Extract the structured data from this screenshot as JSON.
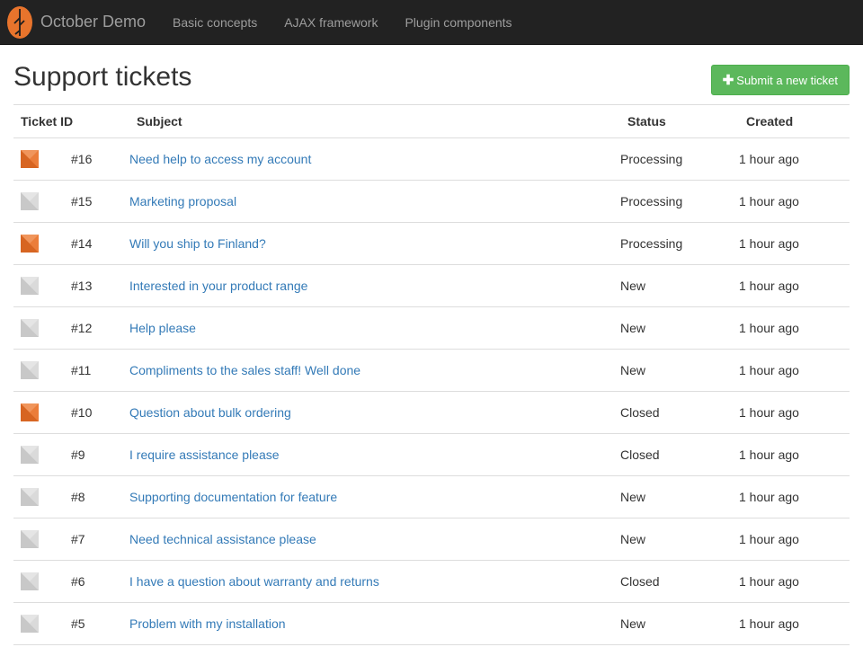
{
  "navbar": {
    "brand": "October Demo",
    "links": [
      "Basic concepts",
      "AJAX framework",
      "Plugin components"
    ]
  },
  "page": {
    "title": "Support tickets",
    "submit_button": "Submit a new ticket"
  },
  "table": {
    "headers": [
      "Ticket ID",
      "Subject",
      "Status",
      "Created"
    ],
    "rows": [
      {
        "avatar": "orange",
        "id": "#16",
        "subject": "Need help to access my account",
        "status": "Processing",
        "created": "1 hour ago"
      },
      {
        "avatar": "gray",
        "id": "#15",
        "subject": "Marketing proposal",
        "status": "Processing",
        "created": "1 hour ago"
      },
      {
        "avatar": "orange",
        "id": "#14",
        "subject": "Will you ship to Finland?",
        "status": "Processing",
        "created": "1 hour ago"
      },
      {
        "avatar": "gray",
        "id": "#13",
        "subject": "Interested in your product range",
        "status": "New",
        "created": "1 hour ago"
      },
      {
        "avatar": "gray",
        "id": "#12",
        "subject": "Help please",
        "status": "New",
        "created": "1 hour ago"
      },
      {
        "avatar": "gray",
        "id": "#11",
        "subject": "Compliments to the sales staff! Well done",
        "status": "New",
        "created": "1 hour ago"
      },
      {
        "avatar": "orange",
        "id": "#10",
        "subject": "Question about bulk ordering",
        "status": "Closed",
        "created": "1 hour ago"
      },
      {
        "avatar": "gray",
        "id": "#9",
        "subject": "I require assistance please",
        "status": "Closed",
        "created": "1 hour ago"
      },
      {
        "avatar": "gray",
        "id": "#8",
        "subject": "Supporting documentation for feature",
        "status": "New",
        "created": "1 hour ago"
      },
      {
        "avatar": "gray",
        "id": "#7",
        "subject": "Need technical assistance please",
        "status": "New",
        "created": "1 hour ago"
      },
      {
        "avatar": "gray",
        "id": "#6",
        "subject": "I have a question about warranty and returns",
        "status": "Closed",
        "created": "1 hour ago"
      },
      {
        "avatar": "gray",
        "id": "#5",
        "subject": "Problem with my installation",
        "status": "New",
        "created": "1 hour ago"
      }
    ]
  },
  "colors": {
    "navbar_bg": "#222222",
    "link": "#337ab7",
    "button_green": "#5cb85c",
    "logo_orange": "#e8742c",
    "avatar_orange": "#e8742c",
    "avatar_gray": "#d6d6d6"
  },
  "icons": {
    "brand": "october-leaf-logo-icon",
    "submit": "plus-icon",
    "avatar_default": "default-avatar-icon"
  }
}
